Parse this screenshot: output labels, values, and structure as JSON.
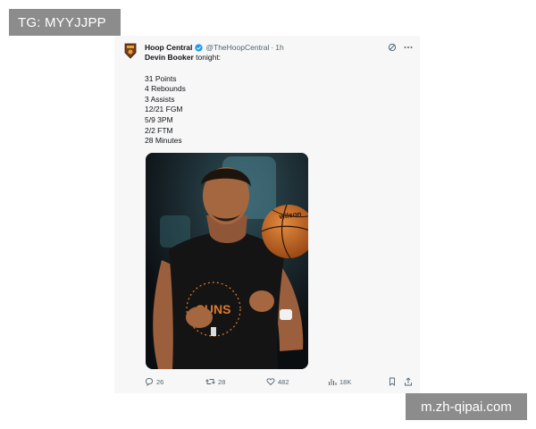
{
  "watermarks": {
    "top_left": "TG: MYYJJPP",
    "bottom_right": "m.zh-qipai.com"
  },
  "tweet": {
    "display_name": "Hoop Central",
    "handle": "@TheHoopCentral",
    "separator": "·",
    "time": "1h",
    "verified": true,
    "intro_name": "Devin Booker",
    "intro_rest": " tonight:",
    "stats": [
      "31 Points",
      "4 Rebounds",
      "3 Assists",
      "12/21 FGM",
      "5/9 3PM",
      "2/2 FTM",
      "28 Minutes"
    ],
    "media": {
      "subject": "basketball player in black warm-up shirt with a basketball",
      "shirt_ring_text": "SUNS BASKETBALL PHXX",
      "shirt_center": "SUNS"
    },
    "actions": {
      "replies": "26",
      "reposts": "28",
      "likes": "482",
      "views": "18K"
    },
    "icons": {
      "header": [
        "grok-icon",
        "more-icon"
      ],
      "actions": [
        "reply-icon",
        "repost-icon",
        "like-icon",
        "views-icon",
        "bookmark-icon",
        "share-icon"
      ]
    }
  },
  "colors": {
    "verified_blue": "#1d9bf0",
    "text": "#0f1419",
    "secondary": "#536471",
    "card_bg": "#f7f7f7",
    "watermark_bg": "#8c8c8c"
  }
}
